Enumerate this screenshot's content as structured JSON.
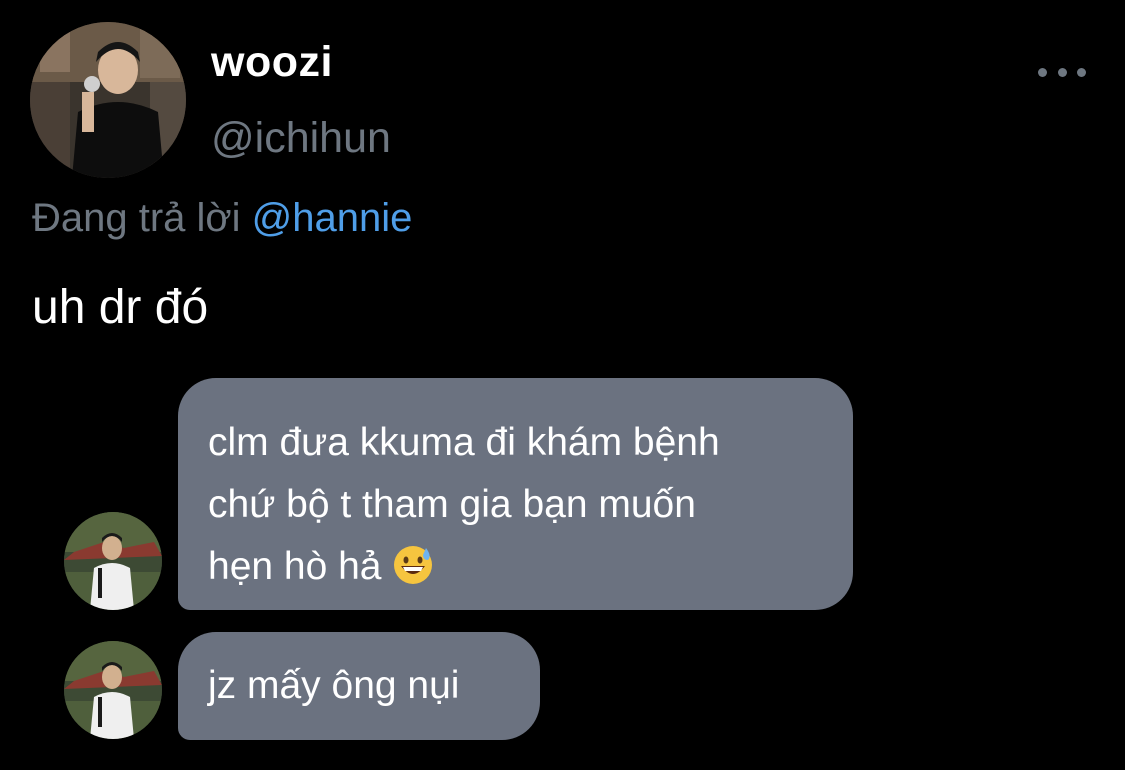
{
  "tweet": {
    "display_name": "woozi",
    "handle": "@ichihun",
    "more_icon": "more-horizontal-icon",
    "reply_prefix": "Đang trả lời",
    "reply_mention": "@hannie",
    "text": "uh dr đó"
  },
  "chat": {
    "messages": [
      {
        "lines": [
          "clm đưa kkuma đi khám bệnh",
          "chứ bộ t tham gia bạn muốn",
          "hẹn hò hả"
        ],
        "emoji": "grinning-face-with-sweat-icon"
      },
      {
        "lines": [
          "jz mấy ông nụi"
        ]
      }
    ]
  },
  "colors": {
    "background": "#000000",
    "secondary_text": "#6e7781",
    "mention": "#4f9ee8",
    "bubble": "#6b7280"
  }
}
